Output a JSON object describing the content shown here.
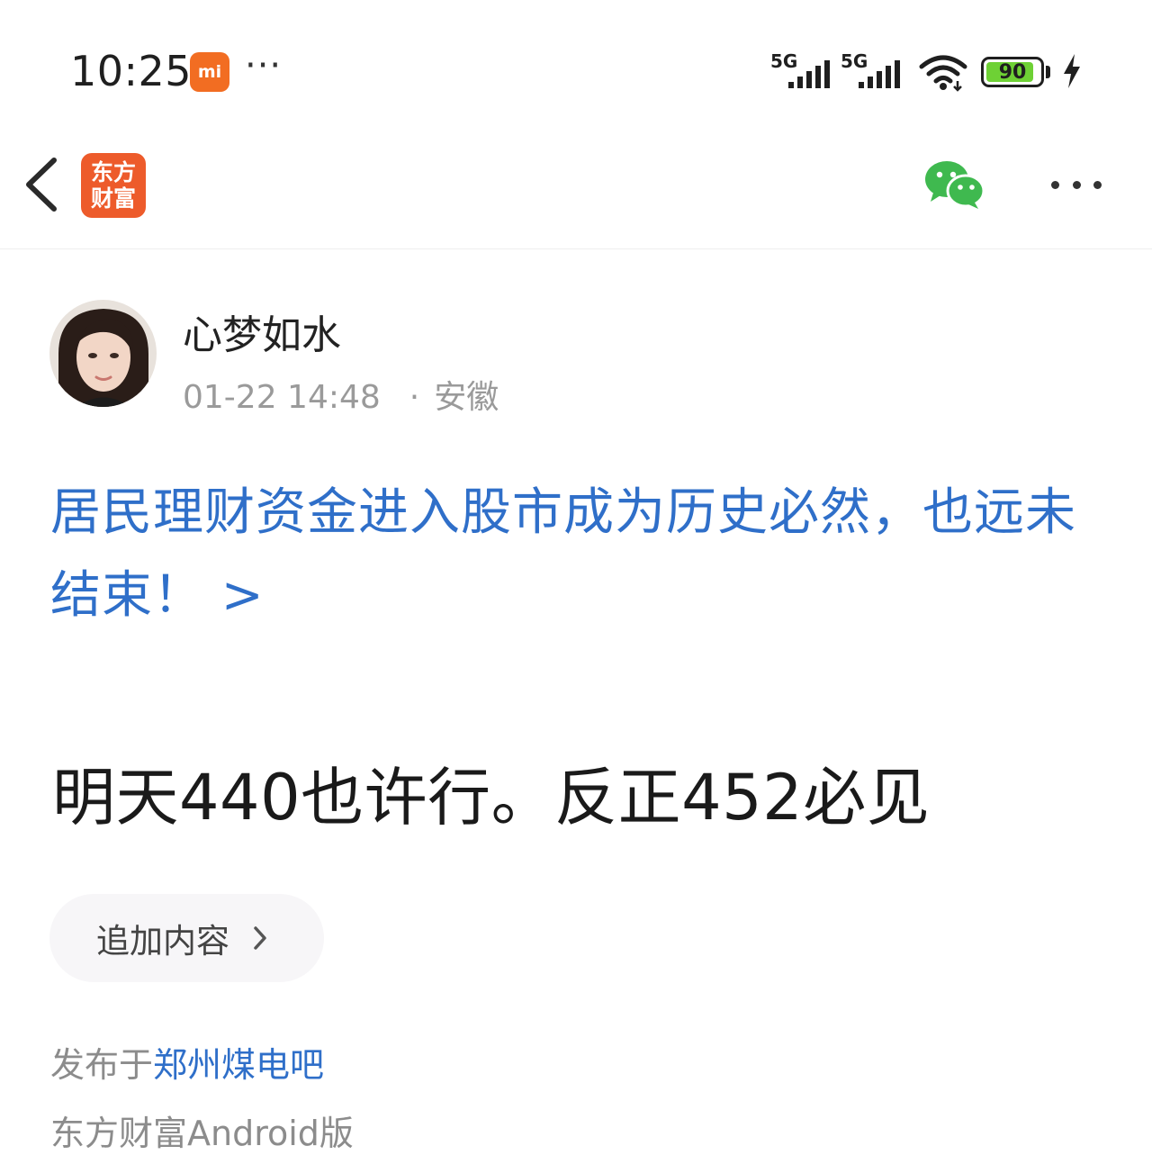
{
  "status_bar": {
    "time": "10:25",
    "mi_badge": "mi",
    "more_dots": "···",
    "signal_1_label": "5G",
    "signal_2_label": "5G",
    "battery_level": "90",
    "battery_fraction": 0.9,
    "battery_color": "#6ed135"
  },
  "nav": {
    "back_icon": "chevron-left-icon",
    "logo_line1": "东方",
    "logo_line2": "财富",
    "share_icon": "wechat-icon",
    "more_icon": "more-horizontal-icon"
  },
  "post": {
    "author_name": "心梦如水",
    "time": "01-22 14:48",
    "separator": "·",
    "location": "安徽",
    "title_link": "居民理财资金进入股市成为历史必然，也远未结束！ >",
    "body": "明天440也许行。反正452必见",
    "append_label": "追加内容",
    "published_prefix": "发布于",
    "forum_name": "郑州煤电吧",
    "client": "东方财富Android版"
  },
  "colors": {
    "link": "#2f6fc9",
    "brand": "#ed5b2b",
    "muted": "#8c8c8c"
  }
}
